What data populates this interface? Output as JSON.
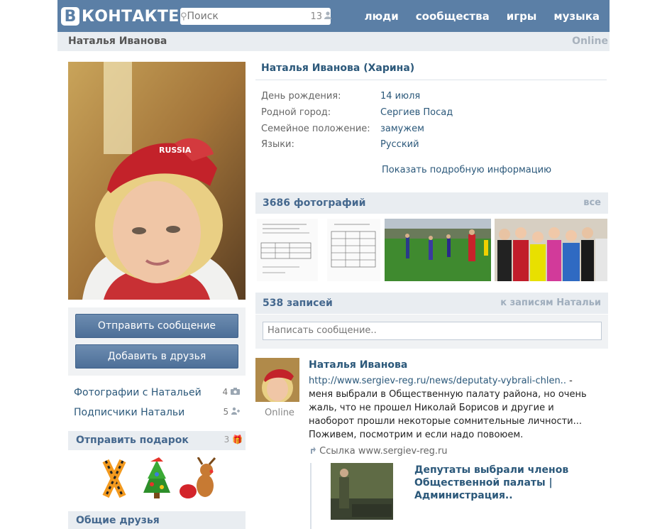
{
  "header": {
    "logo_letter": "В",
    "logo_text": "КОНТАКТЕ",
    "search_placeholder": "Поиск",
    "search_count": "13",
    "nav": [
      "люди",
      "сообщества",
      "игры",
      "музыка"
    ]
  },
  "namebar": {
    "name": "Наталья Иванова",
    "status": "Online"
  },
  "left": {
    "send_message": "Отправить сообщение",
    "add_friend": "Добавить в друзья",
    "links": [
      {
        "label": "Фотографии с Натальей",
        "count": "4"
      },
      {
        "label": "Подписчики Натальи",
        "count": "5"
      }
    ],
    "gifts_title": "Отправить подарок",
    "gifts_count": "3",
    "friends_title": "Общие друзья"
  },
  "profile": {
    "full_name": "Наталья Иванова (Харина)",
    "info": [
      {
        "label": "День рождения:",
        "value": "14 июля"
      },
      {
        "label": "Родной город:",
        "value": "Сергиев Посад"
      },
      {
        "label": "Семейное положение:",
        "value": "замужем"
      },
      {
        "label": "Языки:",
        "value": "Русский"
      }
    ],
    "more_info": "Показать подробную информацию"
  },
  "photos": {
    "title": "3686 фотографий",
    "all": "все"
  },
  "wall": {
    "title": "538 записей",
    "link": "к записям Натальи",
    "input_placeholder": "Написать сообщение.."
  },
  "post": {
    "author": "Наталья Иванова",
    "online": "Online",
    "url": "http://www.sergiev-reg.ru/news/deputaty-vybrali-chlen..",
    "text": " - меня выбрали в Общественную палату района, но очень жаль, что не прошел Николай Борисов и другие и наоборот прошли некоторые сомнительные личности... Поживем, посмотрим и если надо повоюем.",
    "link_label": "Ссылка www.sergiev-reg.ru",
    "attachment_title": "Депутаты выбрали членов Общественной палаты | Администрация.."
  },
  "colors": {
    "header": "#5b7fa6",
    "link": "#2b587a",
    "section_bg": "#e9edf1"
  }
}
